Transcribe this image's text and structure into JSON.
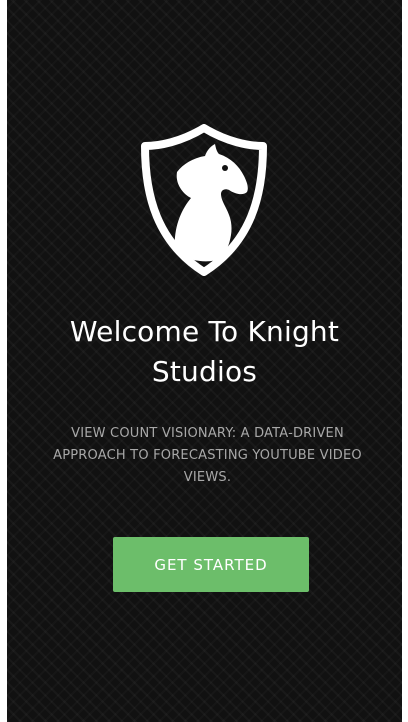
{
  "logo": {
    "icon": "knight-shield-icon"
  },
  "welcome": {
    "title": "Welcome To Knight Studios",
    "subtitle": "VIEW COUNT VISIONARY: A DATA-DRIVEN APPROACH TO FORECASTING YOUTUBE VIDEO VIEWS."
  },
  "cta": {
    "label": "GET STARTED"
  },
  "colors": {
    "background": "#111111",
    "text": "#ffffff",
    "subtitle": "#a8a8a8",
    "accent": "#6cbe6a"
  }
}
